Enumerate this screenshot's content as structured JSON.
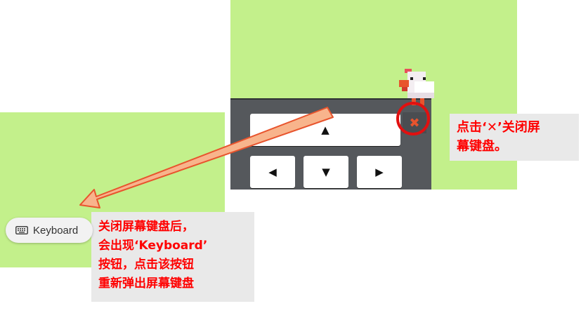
{
  "onscreen_keyboard": {
    "up_key": "▲",
    "left_key": "◀",
    "down_key": "▼",
    "right_key": "▶",
    "close_glyph": "✖"
  },
  "annotations": {
    "close_hint_part1": "点击‘",
    "close_hint_x": "✕",
    "close_hint_part2": "’关闭屏",
    "close_hint_line2": "幕键盘。",
    "reopen_line1": "关闭屏幕键盘后，",
    "reopen_line2": "会出现‘Keyboard’",
    "reopen_line3": "按钮，点击该按钮",
    "reopen_line4": "重新弹出屏幕键盘"
  },
  "keyboard_button": {
    "label": "Keyboard",
    "icon": "keyboard-icon"
  },
  "colors": {
    "game_background": "#c3f08b",
    "keyboard_frame": "#55585c",
    "annotation_text": "#ff0000",
    "annotation_background": "#e9e9e9",
    "arrow_fill": "#f8b48c",
    "arrow_stroke": "#e8542d",
    "highlight_ring": "#e11010"
  }
}
